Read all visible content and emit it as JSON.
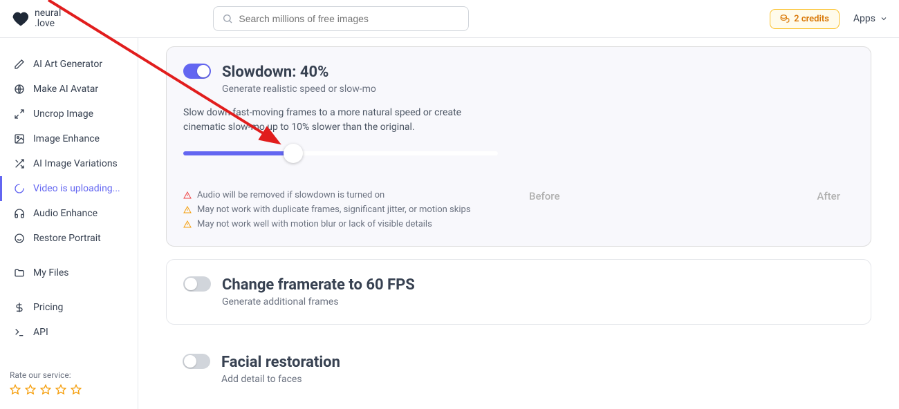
{
  "header": {
    "logo_text_top": "neural",
    "logo_text_bottom": ".love",
    "search_placeholder": "Search millions of free images",
    "credits_label": "2 credits",
    "apps_label": "Apps"
  },
  "sidebar": {
    "items": [
      {
        "label": "AI Art Generator",
        "icon": "pen"
      },
      {
        "label": "Make AI Avatar",
        "icon": "globe"
      },
      {
        "label": "Uncrop Image",
        "icon": "expand"
      },
      {
        "label": "Image Enhance",
        "icon": "image"
      },
      {
        "label": "AI Image Variations",
        "icon": "shuffle"
      },
      {
        "label": "Video is uploading...",
        "icon": "spinner",
        "active": true
      },
      {
        "label": "Audio Enhance",
        "icon": "headphones"
      },
      {
        "label": "Restore Portrait",
        "icon": "smile"
      }
    ],
    "my_files": "My Files",
    "pricing": "Pricing",
    "api": "API",
    "rate_label": "Rate our service:"
  },
  "cards": {
    "slowdown": {
      "toggle_on": true,
      "title": "Slowdown: 40%",
      "subtitle": "Generate realistic speed or slow-mo",
      "description": "Slow down fast-moving frames to a more natural speed or create cinematic slow-mo up to 10% slower than the original.",
      "slider_percent": 35,
      "warnings": [
        {
          "icon": "alert-red",
          "text": "Audio will be removed if slowdown is turned on"
        },
        {
          "icon": "alert-orange",
          "text": "May not work with duplicate frames, significant jitter, or motion skips"
        },
        {
          "icon": "alert-orange",
          "text": "May not work well with motion blur or lack of visible details"
        }
      ],
      "before_label": "Before",
      "after_label": "After"
    },
    "framerate": {
      "toggle_on": false,
      "title": "Change framerate to 60 FPS",
      "subtitle": "Generate additional frames"
    },
    "facial": {
      "toggle_on": false,
      "title": "Facial restoration",
      "subtitle": "Add detail to faces"
    }
  }
}
